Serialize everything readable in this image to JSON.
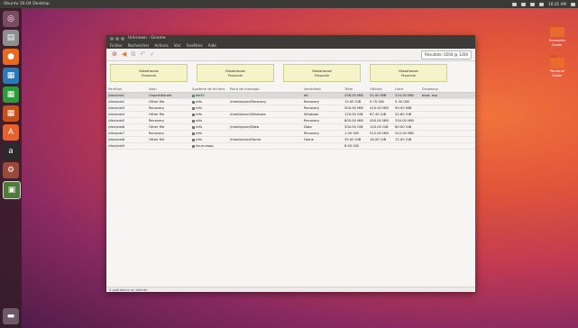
{
  "topbar": {
    "title": "Ubuntu 16.04 Desktop",
    "time": "10:31 AM"
  },
  "launcher": {
    "items": [
      "dash-icon",
      "files-icon",
      "firefox-icon",
      "writer-icon",
      "calc-icon",
      "impress-icon",
      "software-icon",
      "amazon-icon",
      "settings-icon",
      "terminal-icon"
    ]
  },
  "desktop": {
    "icons": [
      {
        "label": "Examples\nFolder"
      },
      {
        "label": "Personal\nFolder"
      }
    ]
  },
  "window": {
    "title": "Unknown - Gnome",
    "menu": [
      "Fichier",
      "Rechercher",
      "Actions",
      "Voir",
      "Fenêtres",
      "Aide"
    ],
    "toolbar": {
      "filter": "Résultats: 0204 @ 1200"
    },
    "cards": [
      {
        "line1": "Glasshouse",
        "line2": "Fraucoin"
      },
      {
        "line1": "Glasshouse",
        "line2": "Fraucoin"
      },
      {
        "line1": "Glasshouse",
        "line2": "Fraucoin"
      },
      {
        "line1": "Glasshouse",
        "line2": "Fraucoin"
      }
    ],
    "table": {
      "headers": [
        "Partition",
        "Nom",
        "Système de fichiers",
        "Point de montage",
        "Identifiant",
        "Taille",
        "Utilisée",
        "Libre",
        "Drapeaux"
      ],
      "rows": [
        [
          "/dev/sda1",
          "Unpartitioned",
          "fat32",
          "",
          "efi",
          "256.00 MiB",
          "31.00 MiB",
          "225.00 MiB",
          "boot, esp"
        ],
        [
          "/dev/sda2",
          "Other file",
          "ntfs",
          "/media/user/Recovery",
          "Recovery",
          "15.00 GiB",
          "9.70 GiB",
          "5.30 GiB",
          ""
        ],
        [
          "/dev/sda3",
          "Recovery",
          "ntfs",
          "",
          "Recovery",
          "500.00 MiB",
          "410.00 MiB",
          "90.00 MiB",
          ""
        ],
        [
          "/dev/sda4",
          "Other file",
          "ntfs",
          "/media/user/Windows",
          "Windows",
          "120.00 GiB",
          "67.40 GiB",
          "52.60 GiB",
          ""
        ],
        [
          "/dev/sda5",
          "Recovery",
          "ntfs",
          "",
          "Recovery",
          "800.00 MiB",
          "450.00 MiB",
          "350.00 MiB",
          ""
        ],
        [
          "/dev/sda6",
          "Other file",
          "ntfs",
          "/media/user/Data",
          "Data",
          "200.00 GiB",
          "120.00 GiB",
          "80.00 GiB",
          ""
        ],
        [
          "/dev/sda7",
          "Recovery",
          "ntfs",
          "",
          "Recovery",
          "1.00 GiB",
          "512.00 MiB",
          "512.00 MiB",
          ""
        ],
        [
          "/dev/sda8",
          "Other file",
          "ntfs",
          "/media/user/Home",
          "Home",
          "30.00 GiB",
          "18.00 GiB",
          "12.00 GiB",
          ""
        ],
        [
          "/dev/sda9",
          "",
          "linux-swap",
          "",
          "",
          "8.00 GiB",
          "",
          "",
          ""
        ]
      ]
    },
    "status": "0 opérations en attente"
  }
}
